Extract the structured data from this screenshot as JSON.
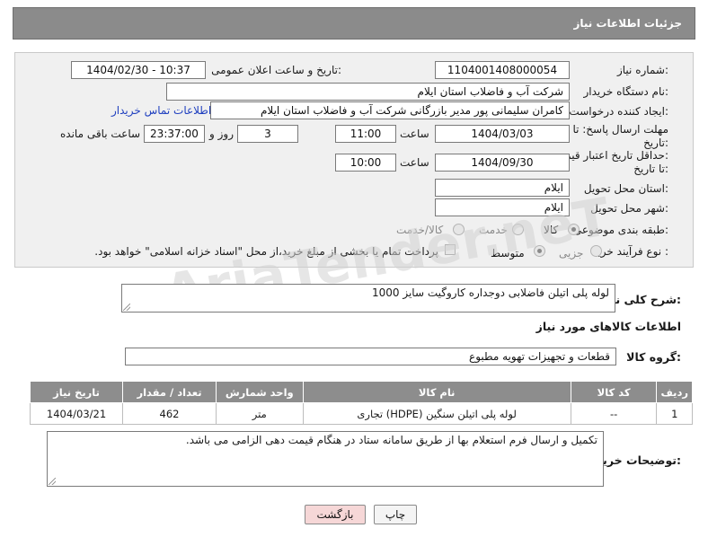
{
  "header": {
    "title": "جزئیات اطلاعات نیاز"
  },
  "fields": {
    "need_number_label": "شماره نیاز:",
    "need_number_value": "1104001408000054",
    "announce_label": "تاریخ و ساعت اعلان عمومی:",
    "announce_value": "1404/02/30 - 10:37",
    "buyer_org_label": "نام دستگاه خریدار:",
    "buyer_org_value": "شرکت آب و فاضلاب استان ایلام",
    "creator_label": "ایجاد کننده درخواست:",
    "creator_value": "کامران سلیمانی پور مدیر بازرگانی شرکت آب و فاضلاب استان ایلام",
    "contact_link": "اطلاعات تماس خریدار",
    "deadline_label_1": "مهلت ارسال پاسخ: تا",
    "deadline_label_2": "تاریخ:",
    "deadline_date": "1404/03/03",
    "time_label": "ساعت",
    "deadline_time": "11:00",
    "days_value": "3",
    "days_label": "روز و",
    "remaining_time": "23:37:00",
    "remaining_label": "ساعت باقی مانده",
    "validity_label_1": "حداقل تاریخ اعتبار قیمت:",
    "validity_label_2": "تا تاریخ:",
    "validity_date": "1404/09/30",
    "validity_time": "10:00",
    "province_label": "استان محل تحویل:",
    "province_value": "ایلام",
    "city_label": "شهر محل تحویل:",
    "city_value": "ایلام",
    "category_label": "طبقه بندی موضوعی:",
    "category_options": [
      "کالا",
      "خدمت",
      "کالا/خدمت"
    ],
    "category_selected": "کالا",
    "process_label": "نوع فرآیند خرید :",
    "process_options": [
      "جزیی",
      "متوسط"
    ],
    "process_selected": "متوسط",
    "payment_note": "پرداخت تمام یا بخشی از مبلغ خرید،از محل \"اسناد خزانه اسلامی\" خواهد بود."
  },
  "description": {
    "label": "شرح کلی نیاز:",
    "value": "لوله پلی اتیلن فاضلابی دوجداره کاروگیت سایز 1000"
  },
  "goods_section": {
    "title": "اطلاعات کالاهای مورد نیاز",
    "group_label": "گروه کالا:",
    "group_value": "قطعات و تجهیزات تهویه مطبوع"
  },
  "table": {
    "headers": [
      "ردیف",
      "کد کالا",
      "نام کالا",
      "واحد شمارش",
      "تعداد / مقدار",
      "تاریخ نیاز"
    ],
    "rows": [
      [
        "1",
        "--",
        "لوله پلی اتیلن سنگین (HDPE) تجاری",
        "متر",
        "462",
        "1404/03/21"
      ]
    ]
  },
  "buyer_notes": {
    "label": "توضیحات خریدار:",
    "value": "تکمیل و ارسال فرم استعلام بها از طریق سامانه ستاد در هنگام قیمت دهی الزامی می باشد."
  },
  "buttons": {
    "print": "چاپ",
    "back": "بازگشت"
  },
  "watermark": "AriaTender.neT",
  "colors": {
    "header_bg": "#8b8b8b",
    "link": "#1f3fbf",
    "back_button_bg": "#f6d7d7"
  }
}
